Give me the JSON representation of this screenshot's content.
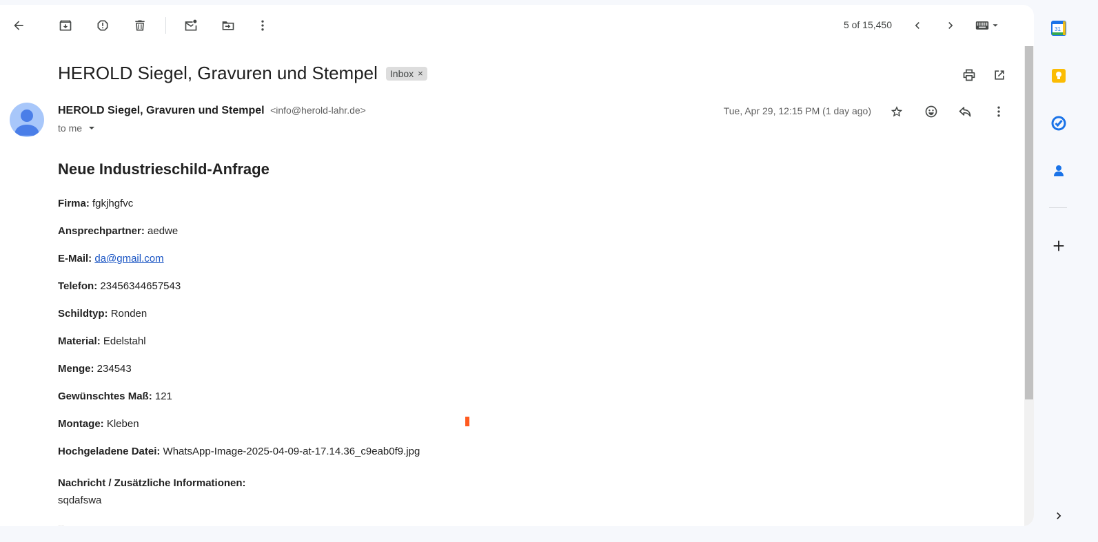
{
  "toolbar": {
    "pager_text": "5 of 15,450",
    "icons": [
      "back-arrow-icon",
      "archive-icon",
      "report-spam-icon",
      "delete-icon",
      "mark-unread-icon",
      "move-to-icon",
      "more-vert-icon",
      "chevron-left-icon",
      "chevron-right-icon",
      "keyboard-icon",
      "dropdown-arrow-icon"
    ]
  },
  "email": {
    "subject": "HEROLD Siegel, Gravuren und Stempel",
    "label_chip": "Inbox",
    "label_remove": "×",
    "sender_name": "HEROLD Siegel, Gravuren und Stempel",
    "sender_email": "<info@herold-lahr.de>",
    "to_text": "to me",
    "date": "Tue, Apr 29, 12:15 PM (1 day ago)"
  },
  "body": {
    "heading": "Neue Industrieschild-Anfrage",
    "fields": [
      {
        "label": "Firma:",
        "value": "fgkjhgfvc"
      },
      {
        "label": "Ansprechpartner:",
        "value": "aedwe"
      },
      {
        "label": "E-Mail:",
        "value": "da@gmail.com"
      },
      {
        "label": "Telefon:",
        "value": "23456344657543"
      },
      {
        "label": "Schildtyp:",
        "value": "Ronden"
      },
      {
        "label": "Material:",
        "value": "Edelstahl"
      },
      {
        "label": "Menge:",
        "value": "234543"
      },
      {
        "label": "Gewünschtes Maß:",
        "value": "121"
      },
      {
        "label": "Montage:",
        "value": "Kleben"
      },
      {
        "label": "Hochgeladene Datei:",
        "value": "WhatsApp-Image-2025-04-09-at-17.14.36_c9eab0f9.jpg"
      }
    ],
    "message_label": "Nachricht / Zusätzliche Informationen:",
    "message_text": "sqdafswa",
    "signature": "--"
  },
  "side_panel": {
    "icons": [
      "calendar-icon",
      "keep-icon",
      "tasks-icon",
      "contacts-icon",
      "add-icon",
      "expand-icon"
    ],
    "calendar_day": "31"
  },
  "colors": {
    "link": "#1a55c4",
    "avatar_bg": "#a8c7fa",
    "avatar_fg": "#4a7ee8",
    "keep_yellow": "#fbbc04",
    "tasks_blue": "#1a73e8"
  }
}
